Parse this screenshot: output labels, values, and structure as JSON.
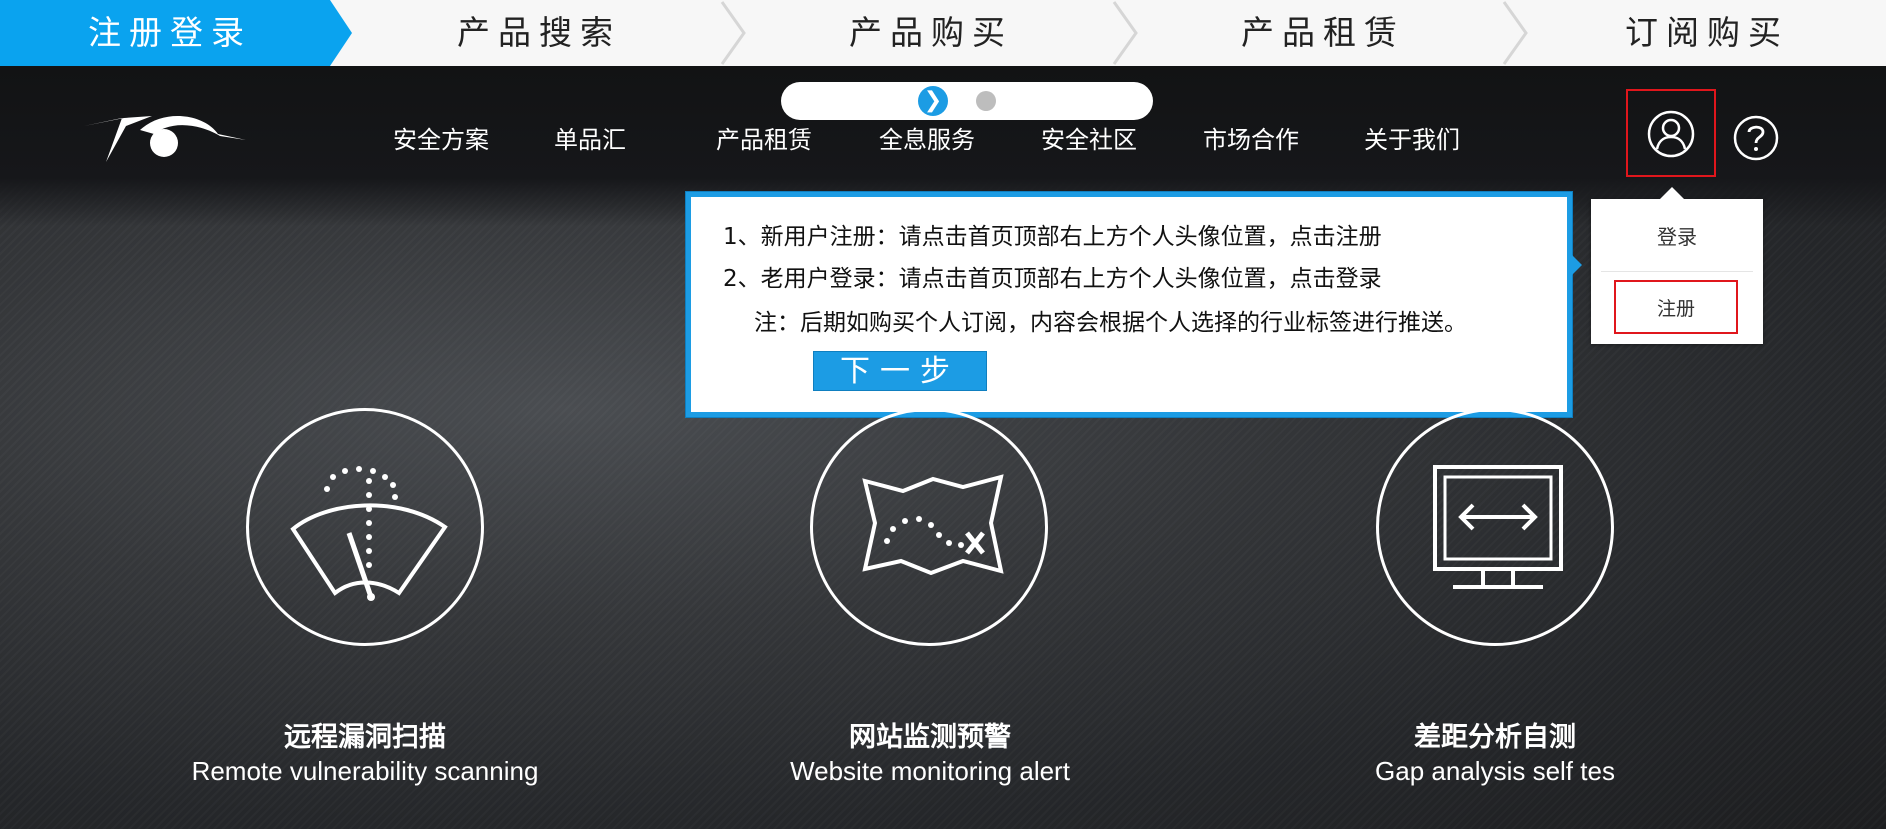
{
  "steps": [
    "注册登录",
    "产品搜索",
    "产品购买",
    "产品租赁",
    "订阅购买"
  ],
  "colors": {
    "accent": "#1c9ce4",
    "highlight": "#e0161c"
  },
  "header": {
    "logo": "brand-logo",
    "nav": [
      "安全方案",
      "单品汇",
      "产品租赁",
      "全息服务",
      "安全社区",
      "市场合作",
      "关于我们"
    ],
    "user_icon": "user-icon",
    "help_icon": "help-icon",
    "slider_next_symbol": "❯"
  },
  "dropdown": {
    "login": "登录",
    "register": "注册"
  },
  "tooltip": {
    "line1": "1、新用户注册：请点击首页顶部右上方个人头像位置，点击注册",
    "line2": "2、老用户登录：请点击首页顶部右上方个人头像位置，点击登录",
    "note": "注：后期如购买个人订阅，内容会根据个人选择的行业标签进行推送。",
    "next_button": "下一步"
  },
  "features": [
    {
      "icon": "wiper-scan-icon",
      "title_cn": "远程漏洞扫描",
      "title_en": "Remote vulnerability scanning"
    },
    {
      "icon": "map-route-icon",
      "title_cn": "网站监测预警",
      "title_en": "Website monitoring alert"
    },
    {
      "icon": "monitor-arrows-icon",
      "title_cn": "差距分析自测",
      "title_en": "Gap analysis self tes"
    }
  ]
}
